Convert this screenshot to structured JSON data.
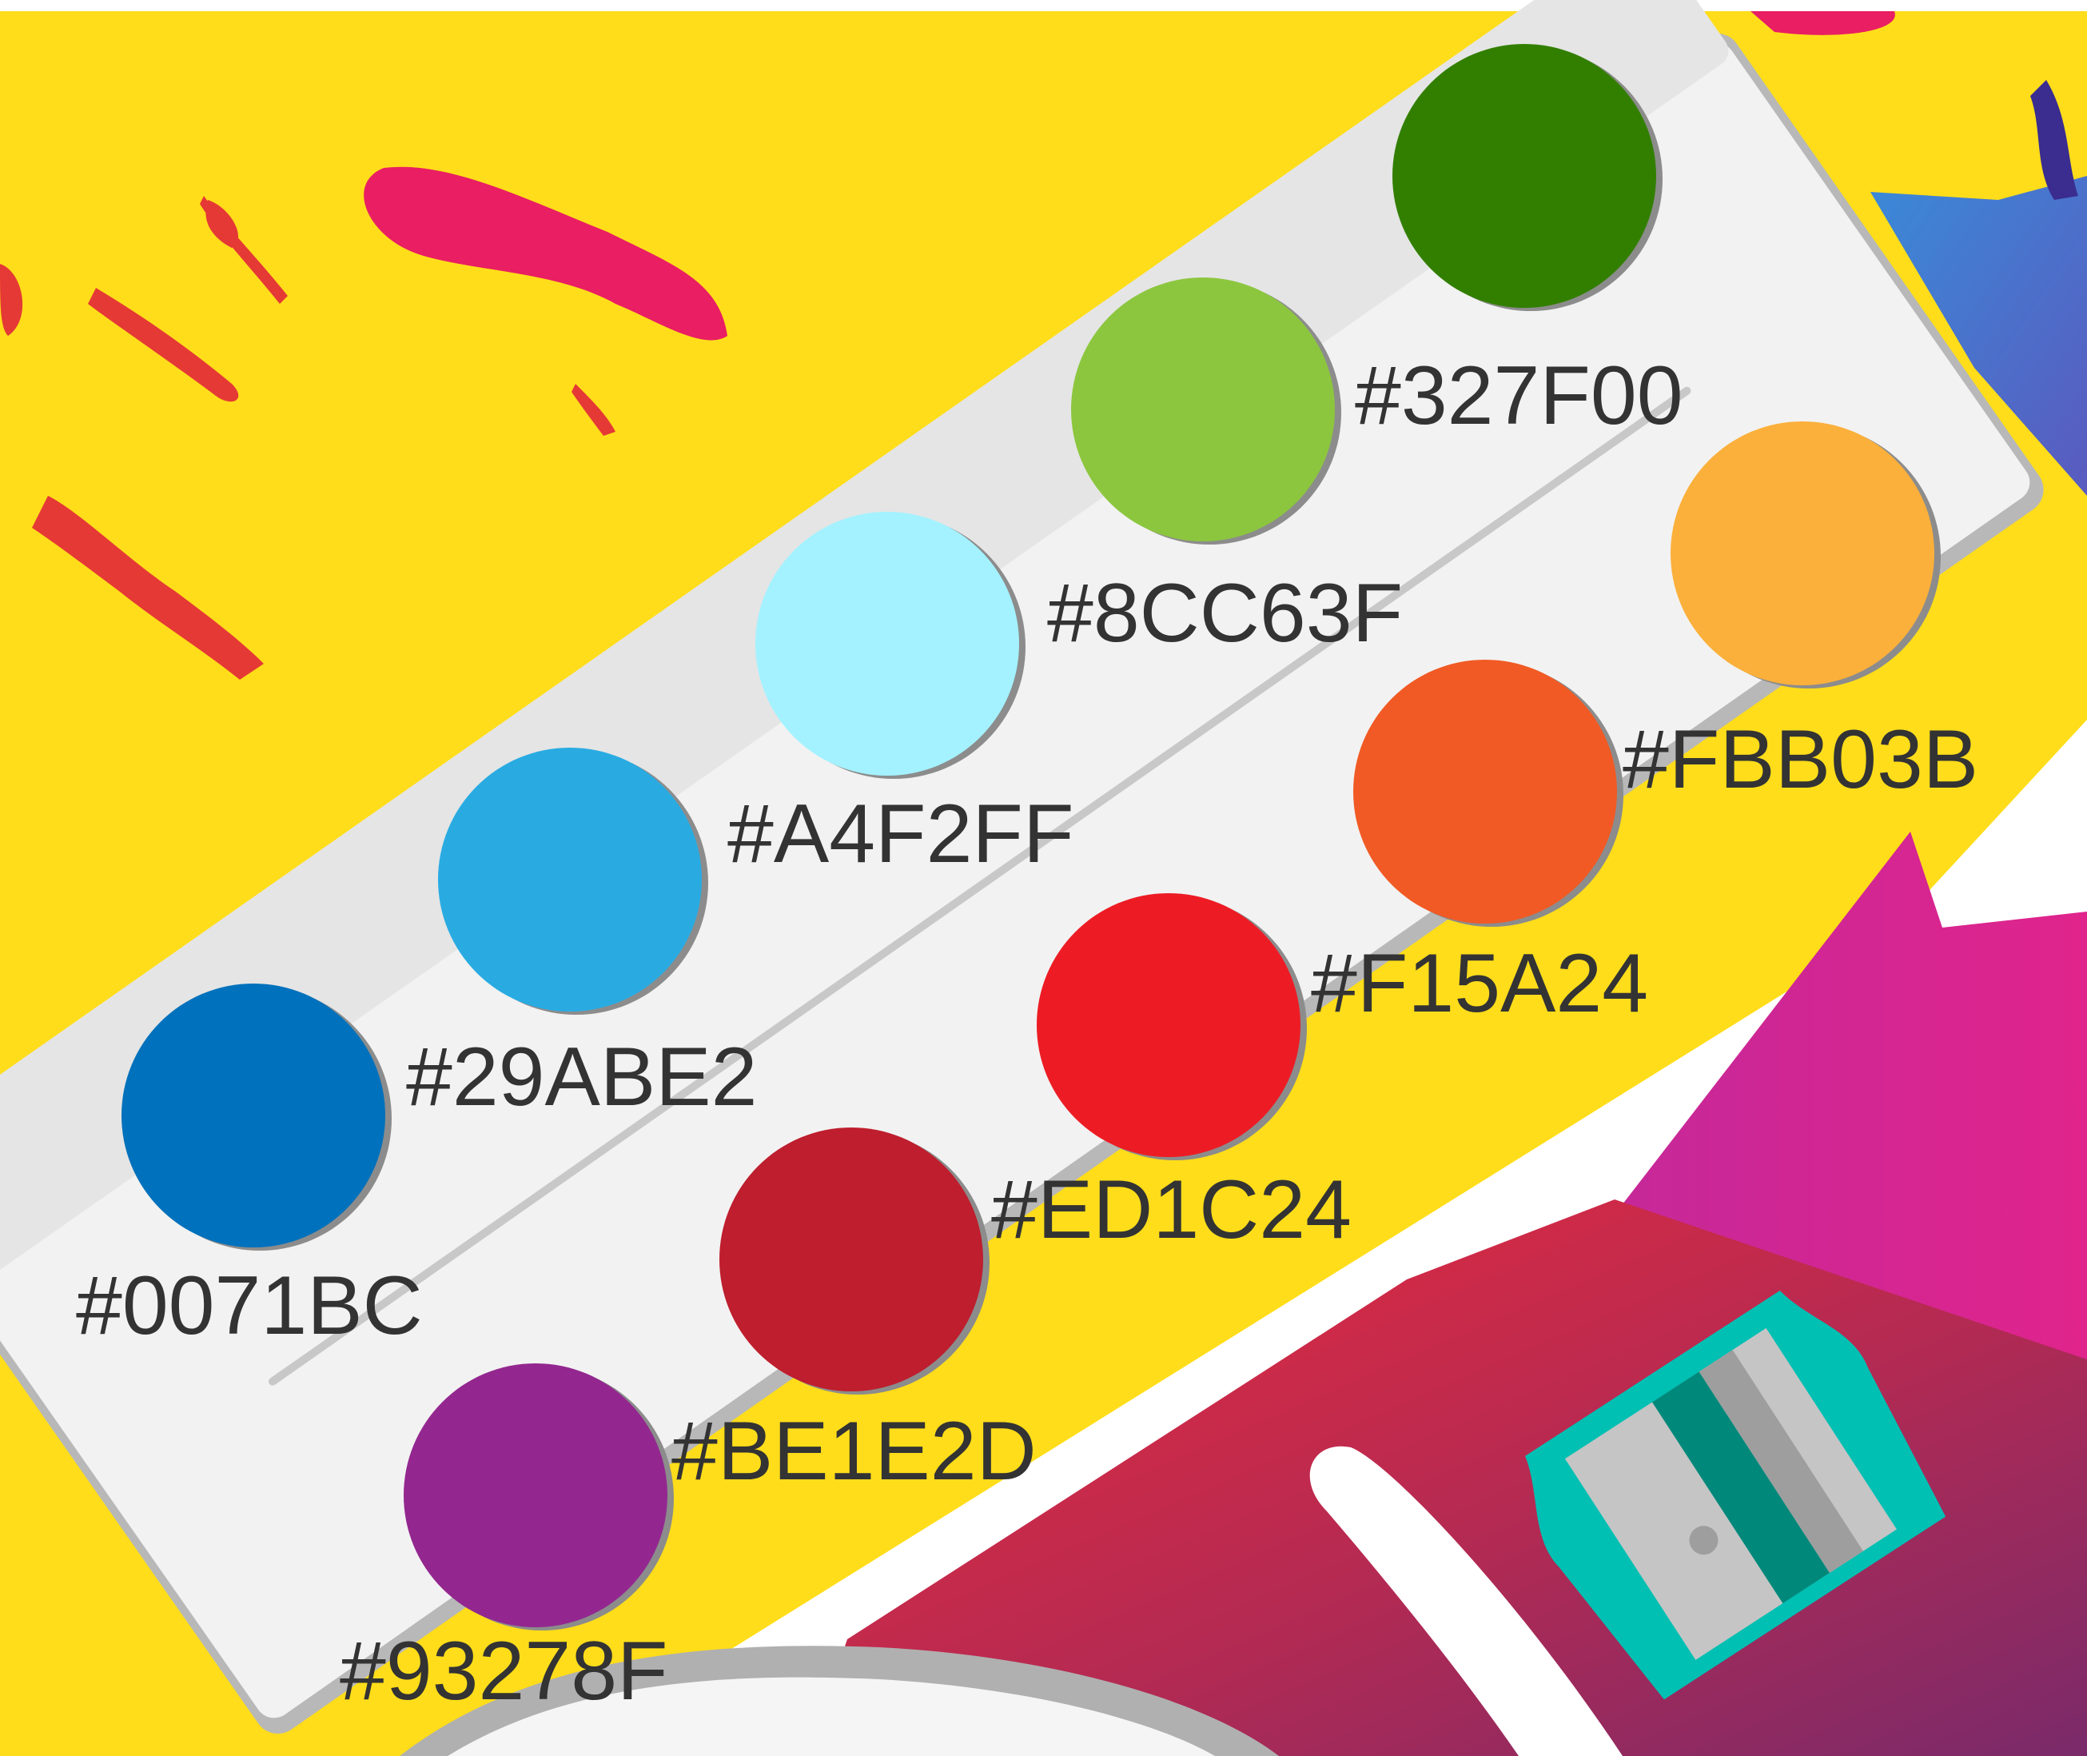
{
  "palette": {
    "swatches": [
      {
        "color": "#327F00",
        "label": "#327F00"
      },
      {
        "color": "#8CC63F",
        "label": "#8CC63F"
      },
      {
        "color": "#A4F2FF",
        "label": "#A4F2FF"
      },
      {
        "color": "#29ABE2",
        "label": "#29ABE2"
      },
      {
        "color": "#0071BC",
        "label": "#0071BC"
      },
      {
        "color": "#FBB03B",
        "label": "#FBB03B"
      },
      {
        "color": "#F15A24",
        "label": "#F15A24"
      },
      {
        "color": "#ED1C24",
        "label": "#ED1C24"
      },
      {
        "color": "#BE1E2D",
        "label": "#BE1E2D"
      },
      {
        "color": "#93278F",
        "label": "#93278F"
      }
    ]
  },
  "colors": {
    "background_yellow": "#FFDD1A",
    "splash_pink": "#E91E63",
    "splash_red": "#E53935",
    "tray_body": "#F2F2F2",
    "tray_lid": "#E5E5E5",
    "tray_edge": "#B8B8B8",
    "sharpener_teal": "#00BFB3",
    "label_text": "#333333"
  },
  "icons": [
    "paint-splash",
    "pencil-sharpener-icon",
    "paintbrush-handle"
  ]
}
